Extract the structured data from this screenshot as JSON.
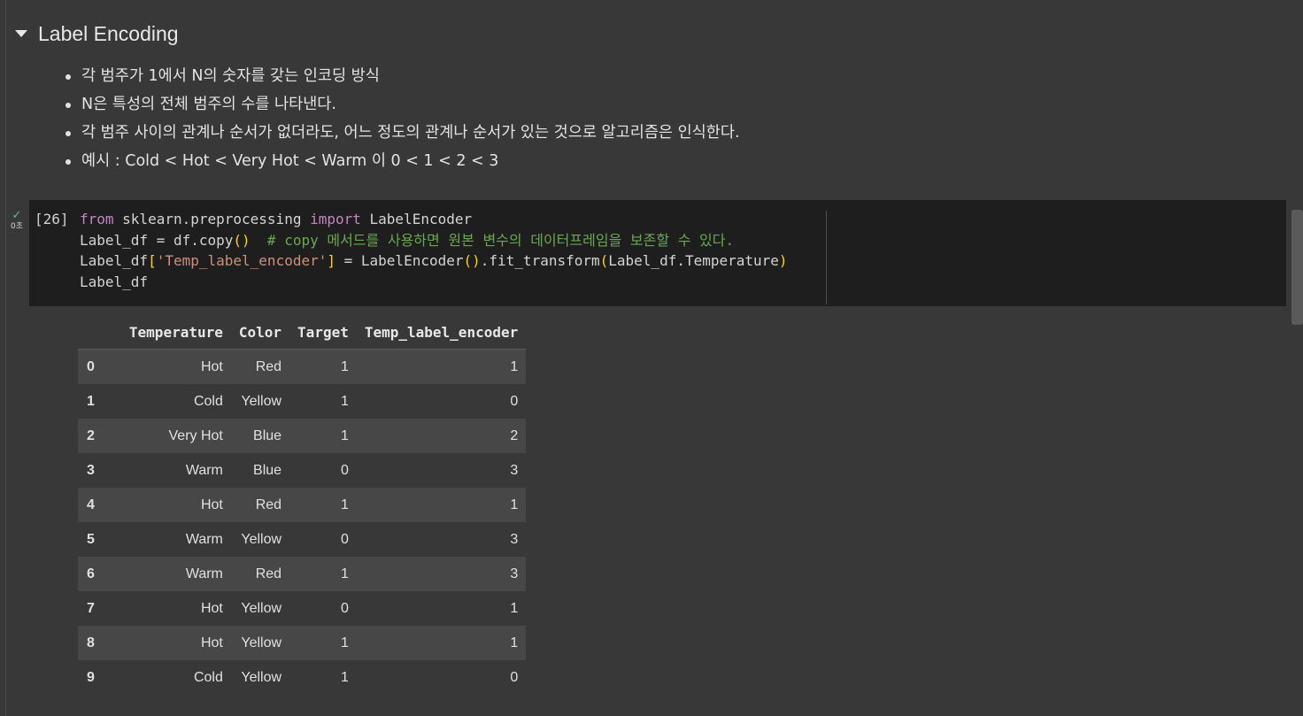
{
  "section": {
    "title": "Label Encoding"
  },
  "bullets": [
    "각 범주가 1에서 N의 숫자를 갖는 인코딩 방식",
    "N은 특성의 전체 범주의 수를 나타낸다.",
    "각 범주 사이의 관계나 순서가 없더라도, 어느 정도의 관계나 순서가 있는 것으로 알고리즘은 인식한다.",
    "예시 : Cold < Hot < Very Hot < Warm 이 0 < 1 < 2 < 3"
  ],
  "cell": {
    "execution_count": "[26]",
    "run_time": "0초",
    "code": {
      "l1_from": "from",
      "l1_mod": " sklearn.preprocessing ",
      "l1_import": "import",
      "l1_name": " LabelEncoder",
      "l2_code": "Label_df = df.copy",
      "l2_paren": "()",
      "l2_comment": "  # copy 메서드를 사용하면 원본 변수의 데이터프레임을 보존할 수 있다.",
      "l3_a": "Label_df",
      "l3_ob": "[",
      "l3_str": "'Temp_label_encoder'",
      "l3_cb": "]",
      "l3_b": " = LabelEncoder",
      "l3_p1": "()",
      "l3_c": ".fit_transform",
      "l3_p2": "(",
      "l3_d": "Label_df.Temperature",
      "l3_p3": ")",
      "l4": "Label_df"
    }
  },
  "table": {
    "columns": [
      "Temperature",
      "Color",
      "Target",
      "Temp_label_encoder"
    ],
    "rows": [
      {
        "index": "0",
        "cells": [
          "Hot",
          "Red",
          "1",
          "1"
        ]
      },
      {
        "index": "1",
        "cells": [
          "Cold",
          "Yellow",
          "1",
          "0"
        ]
      },
      {
        "index": "2",
        "cells": [
          "Very Hot",
          "Blue",
          "1",
          "2"
        ]
      },
      {
        "index": "3",
        "cells": [
          "Warm",
          "Blue",
          "0",
          "3"
        ]
      },
      {
        "index": "4",
        "cells": [
          "Hot",
          "Red",
          "1",
          "1"
        ]
      },
      {
        "index": "5",
        "cells": [
          "Warm",
          "Yellow",
          "0",
          "3"
        ]
      },
      {
        "index": "6",
        "cells": [
          "Warm",
          "Red",
          "1",
          "3"
        ]
      },
      {
        "index": "7",
        "cells": [
          "Hot",
          "Yellow",
          "0",
          "1"
        ]
      },
      {
        "index": "8",
        "cells": [
          "Hot",
          "Yellow",
          "1",
          "1"
        ]
      },
      {
        "index": "9",
        "cells": [
          "Cold",
          "Yellow",
          "1",
          "0"
        ]
      }
    ]
  },
  "colors": {
    "background": "#383838",
    "code_background": "#1e1e1e",
    "keyword": "#c586c0",
    "comment": "#6aa84f",
    "string": "#ce9178",
    "bracket": "#ffd700",
    "success": "#5fbf7a"
  },
  "icons": {
    "toggle": "caret-down-icon",
    "run_status": "check-icon"
  }
}
